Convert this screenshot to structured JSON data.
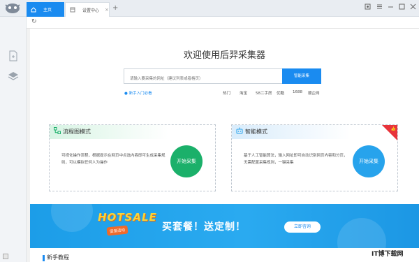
{
  "tabs": [
    {
      "label": "主页",
      "icon": "home-icon",
      "active": true
    },
    {
      "label": "设置中心",
      "icon": "page-icon",
      "active": false
    }
  ],
  "add_tab": "+",
  "window_controls": [
    "skin-icon",
    "menu-icon",
    "minimize-icon",
    "maximize-icon",
    "close-icon"
  ],
  "sidebar": {
    "items": [
      "new-task-icon",
      "task-layers-icon"
    ]
  },
  "main": {
    "title": "欢迎使用后羿采集器",
    "search_placeholder": "请输入要采集的网址（建议列表或者格页）",
    "search_button": "智能采集",
    "newbie_link": "新手入门必看",
    "quick_links": [
      "热门",
      "淘宝",
      "58二手房",
      "优酷",
      "1688",
      "顺企网"
    ]
  },
  "cards": [
    {
      "title": "流程图模式",
      "desc": "可视化操作流程，根据提示在网页中点选内容即可生成采集规则，可以模拟任何人为操作",
      "button": "开始采集",
      "color": "#1bb06a"
    },
    {
      "title": "智能模式",
      "desc": "基于人工智能算法，输入网址即可自动识别网页内容和分页，无需配置采集规则，一键采集",
      "button": "开始采集",
      "color": "#27a3ec"
    }
  ],
  "banner": {
    "hot": "HOTSALE",
    "tag": "促销活动",
    "text": "买套餐！送定制！",
    "button": "立即咨询"
  },
  "below_title": "新手教程",
  "watermark": "IT博下载网",
  "accent": "#1a8bf0"
}
